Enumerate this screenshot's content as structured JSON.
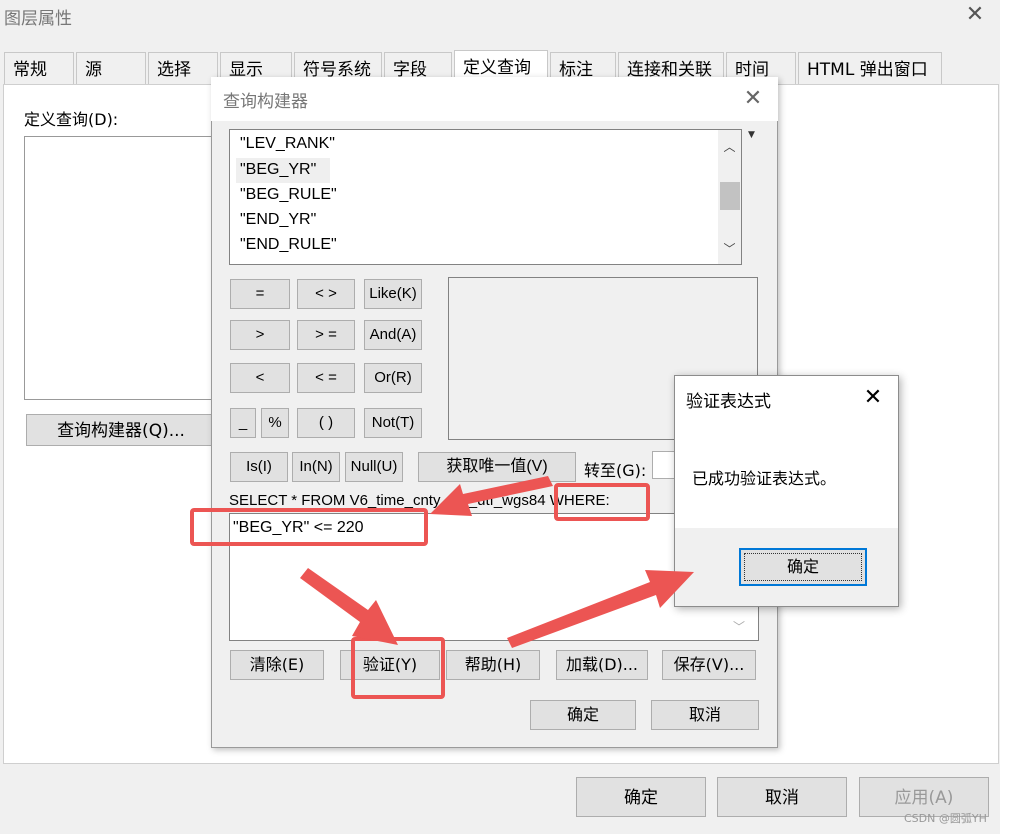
{
  "layer_window": {
    "title": "图层属性",
    "close": "✕",
    "tabs": [
      "常规",
      "源",
      "选择",
      "显示",
      "符号系统",
      "字段",
      "定义查询",
      "标注",
      "连接和关联",
      "时间",
      "HTML 弹出窗口"
    ],
    "definition_query_label": "定义查询(D):",
    "query_builder_button": "查询构建器(Q)...",
    "ok": "确定",
    "cancel": "取消",
    "apply": "应用(A)"
  },
  "query_builder": {
    "title": "查询构建器",
    "close": "✕",
    "fields": [
      "\"LEV_RANK\"",
      "\"BEG_YR\"",
      "\"BEG_RULE\"",
      "\"END_YR\"",
      "\"END_RULE\""
    ],
    "selected_field": "\"BEG_YR\"",
    "operators": {
      "eq": "=",
      "ne": "< >",
      "like": "Like(K)",
      "gt": ">",
      "ge": "> =",
      "and": "And(A)",
      "lt": "<",
      "le": "< =",
      "or": "Or(R)",
      "underscore": "_",
      "percent": "%",
      "parens": "( )",
      "not": "Not(T)",
      "is": "Is(I)",
      "in": "In(N)",
      "null": "Null(U)"
    },
    "get_unique_values": "获取唯一值(V)",
    "goto_label": "转至(G):",
    "select_clause": "SELECT * FROM V6_time_cnty_pts_utf_wgs84 WHERE:",
    "where_expression": "\"BEG_YR\" <= 220",
    "buttons": {
      "clear": "清除(E)",
      "verify": "验证(Y)",
      "help": "帮助(H)",
      "load": "加载(D)...",
      "save": "保存(V)...",
      "ok": "确定",
      "cancel": "取消"
    }
  },
  "verify_dialog": {
    "title": "验证表达式",
    "close": "✕",
    "message": "已成功验证表达式。",
    "ok": "确定"
  },
  "watermark": "CSDN @圆弧YH",
  "colors": {
    "annotation": "#ec5553",
    "focus": "#0078d7"
  }
}
